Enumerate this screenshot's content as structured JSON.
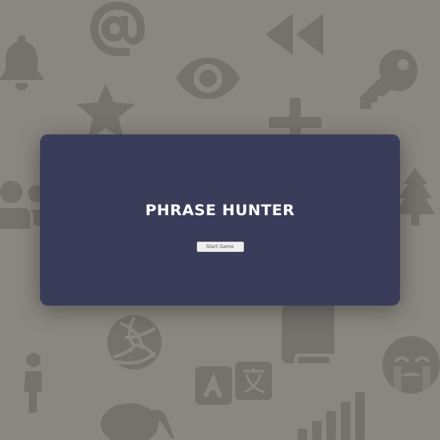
{
  "overlay": {
    "title": "PHRASE HUNTER",
    "start_button_label": "Start Game"
  },
  "background": {
    "color": "#8a8780",
    "icon_color": "#6f6c66",
    "icons": [
      "at-sign-icon",
      "rewind-icon",
      "bell-icon",
      "eye-icon",
      "key-icon",
      "star-icon",
      "plus-icon",
      "users-icon",
      "tree-icon",
      "volleyball-icon",
      "book-icon",
      "person-icon",
      "translate-icon",
      "crying-face-icon",
      "kiwi-icon",
      "signal-icon"
    ]
  },
  "colors": {
    "overlay_bg": "#3a3d59",
    "title_text": "#ffffff",
    "button_bg": "#efefef"
  }
}
